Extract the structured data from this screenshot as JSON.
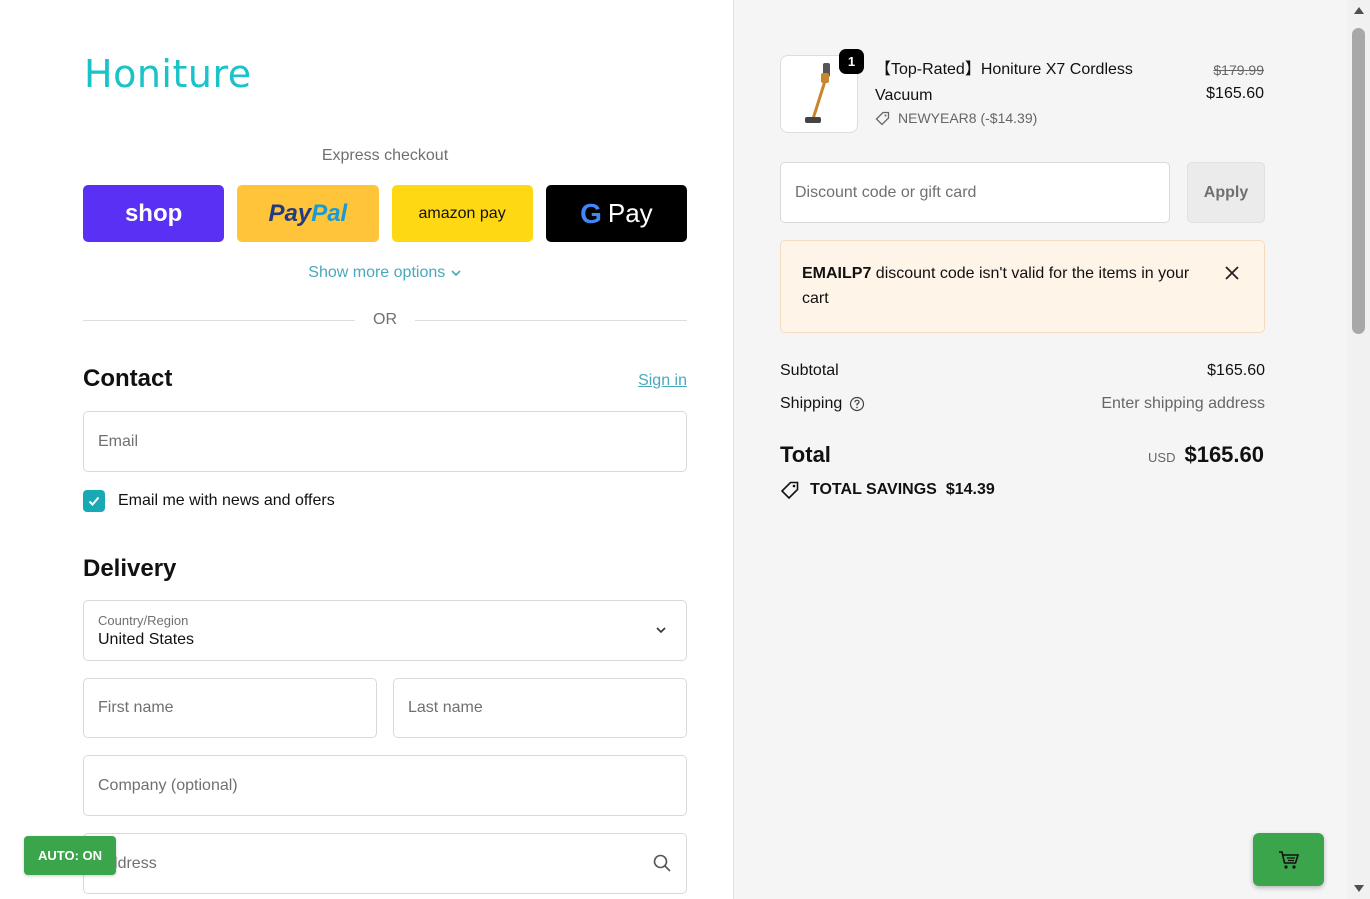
{
  "brand": {
    "logo_text": "Honiture",
    "accent_color": "#19c3c9"
  },
  "express": {
    "label": "Express checkout",
    "buttons": [
      {
        "name": "shop",
        "label": "shop"
      },
      {
        "name": "paypal",
        "label_a": "Pay",
        "label_b": "Pal"
      },
      {
        "name": "amazon",
        "label": "amazon pay"
      },
      {
        "name": "gpay",
        "label_g": "G",
        "label": "Pay"
      }
    ],
    "more_options": "Show more options",
    "or_text": "OR"
  },
  "contact": {
    "title": "Contact",
    "sign_in": "Sign in",
    "email_placeholder": "Email",
    "newsletter_label": "Email me with news and offers",
    "newsletter_checked": true
  },
  "delivery": {
    "title": "Delivery",
    "country_label": "Country/Region",
    "country_value": "United States",
    "first_name_placeholder": "First name",
    "last_name_placeholder": "Last name",
    "company_placeholder": "Company (optional)",
    "address_placeholder": "Address"
  },
  "auto_badge": "AUTO: ON",
  "order": {
    "item": {
      "quantity": "1",
      "name": "【Top-Rated】Honiture X7 Cordless Vacuum",
      "discount": "NEWYEAR8 (-$14.39)",
      "price_original": "$179.99",
      "price_final": "$165.60"
    },
    "discount_placeholder": "Discount code or gift card",
    "apply_label": "Apply",
    "alert": {
      "code": "EMAILP7",
      "message": " discount code isn't valid for the items in your cart"
    },
    "subtotal_label": "Subtotal",
    "subtotal_value": "$165.60",
    "shipping_label": "Shipping",
    "shipping_value": "Enter shipping address",
    "total_label": "Total",
    "total_currency": "USD",
    "total_value": "$165.60",
    "savings_label": "TOTAL SAVINGS",
    "savings_value": "$14.39"
  }
}
